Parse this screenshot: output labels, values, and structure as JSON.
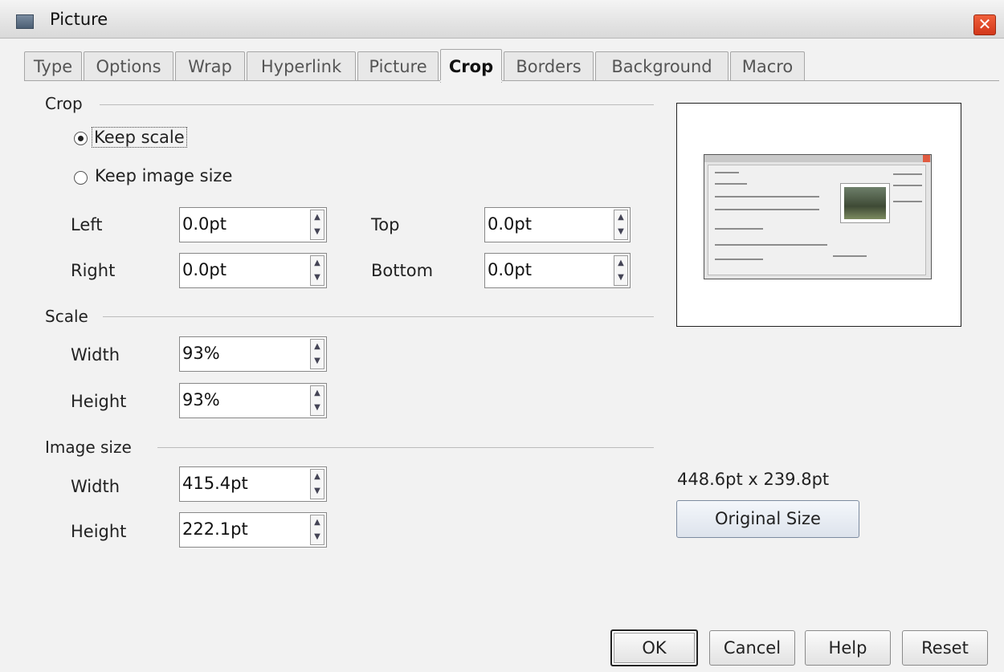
{
  "window": {
    "title": "Picture",
    "close_symbol": "✕"
  },
  "tabs": [
    {
      "label": "Type"
    },
    {
      "label": "Options"
    },
    {
      "label": "Wrap"
    },
    {
      "label": "Hyperlink"
    },
    {
      "label": "Picture"
    },
    {
      "label": "Crop",
      "active": true
    },
    {
      "label": "Borders"
    },
    {
      "label": "Background"
    },
    {
      "label": "Macro"
    }
  ],
  "crop": {
    "group_label": "Crop",
    "keep_scale_label": "Keep scale",
    "keep_image_size_label": "Keep image size",
    "selected": "keep_scale",
    "left": {
      "label": "Left",
      "value": "0.0pt"
    },
    "right": {
      "label": "Right",
      "value": "0.0pt"
    },
    "top": {
      "label": "Top",
      "value": "0.0pt"
    },
    "bottom": {
      "label": "Bottom",
      "value": "0.0pt"
    }
  },
  "scale": {
    "group_label": "Scale",
    "width": {
      "label": "Width",
      "value": "93%"
    },
    "height": {
      "label": "Height",
      "value": "93%"
    }
  },
  "image_size": {
    "group_label": "Image size",
    "width": {
      "label": "Width",
      "value": "415.4pt"
    },
    "height": {
      "label": "Height",
      "value": "222.1pt"
    }
  },
  "original": {
    "size_text": "448.6pt x 239.8pt",
    "button_label": "Original Size"
  },
  "buttons": {
    "ok": "OK",
    "cancel": "Cancel",
    "help": "Help",
    "reset": "Reset"
  },
  "icons": {
    "title_icon": "picture-dialog-icon",
    "close": "close-icon",
    "spin_up": "▲",
    "spin_down": "▼"
  }
}
